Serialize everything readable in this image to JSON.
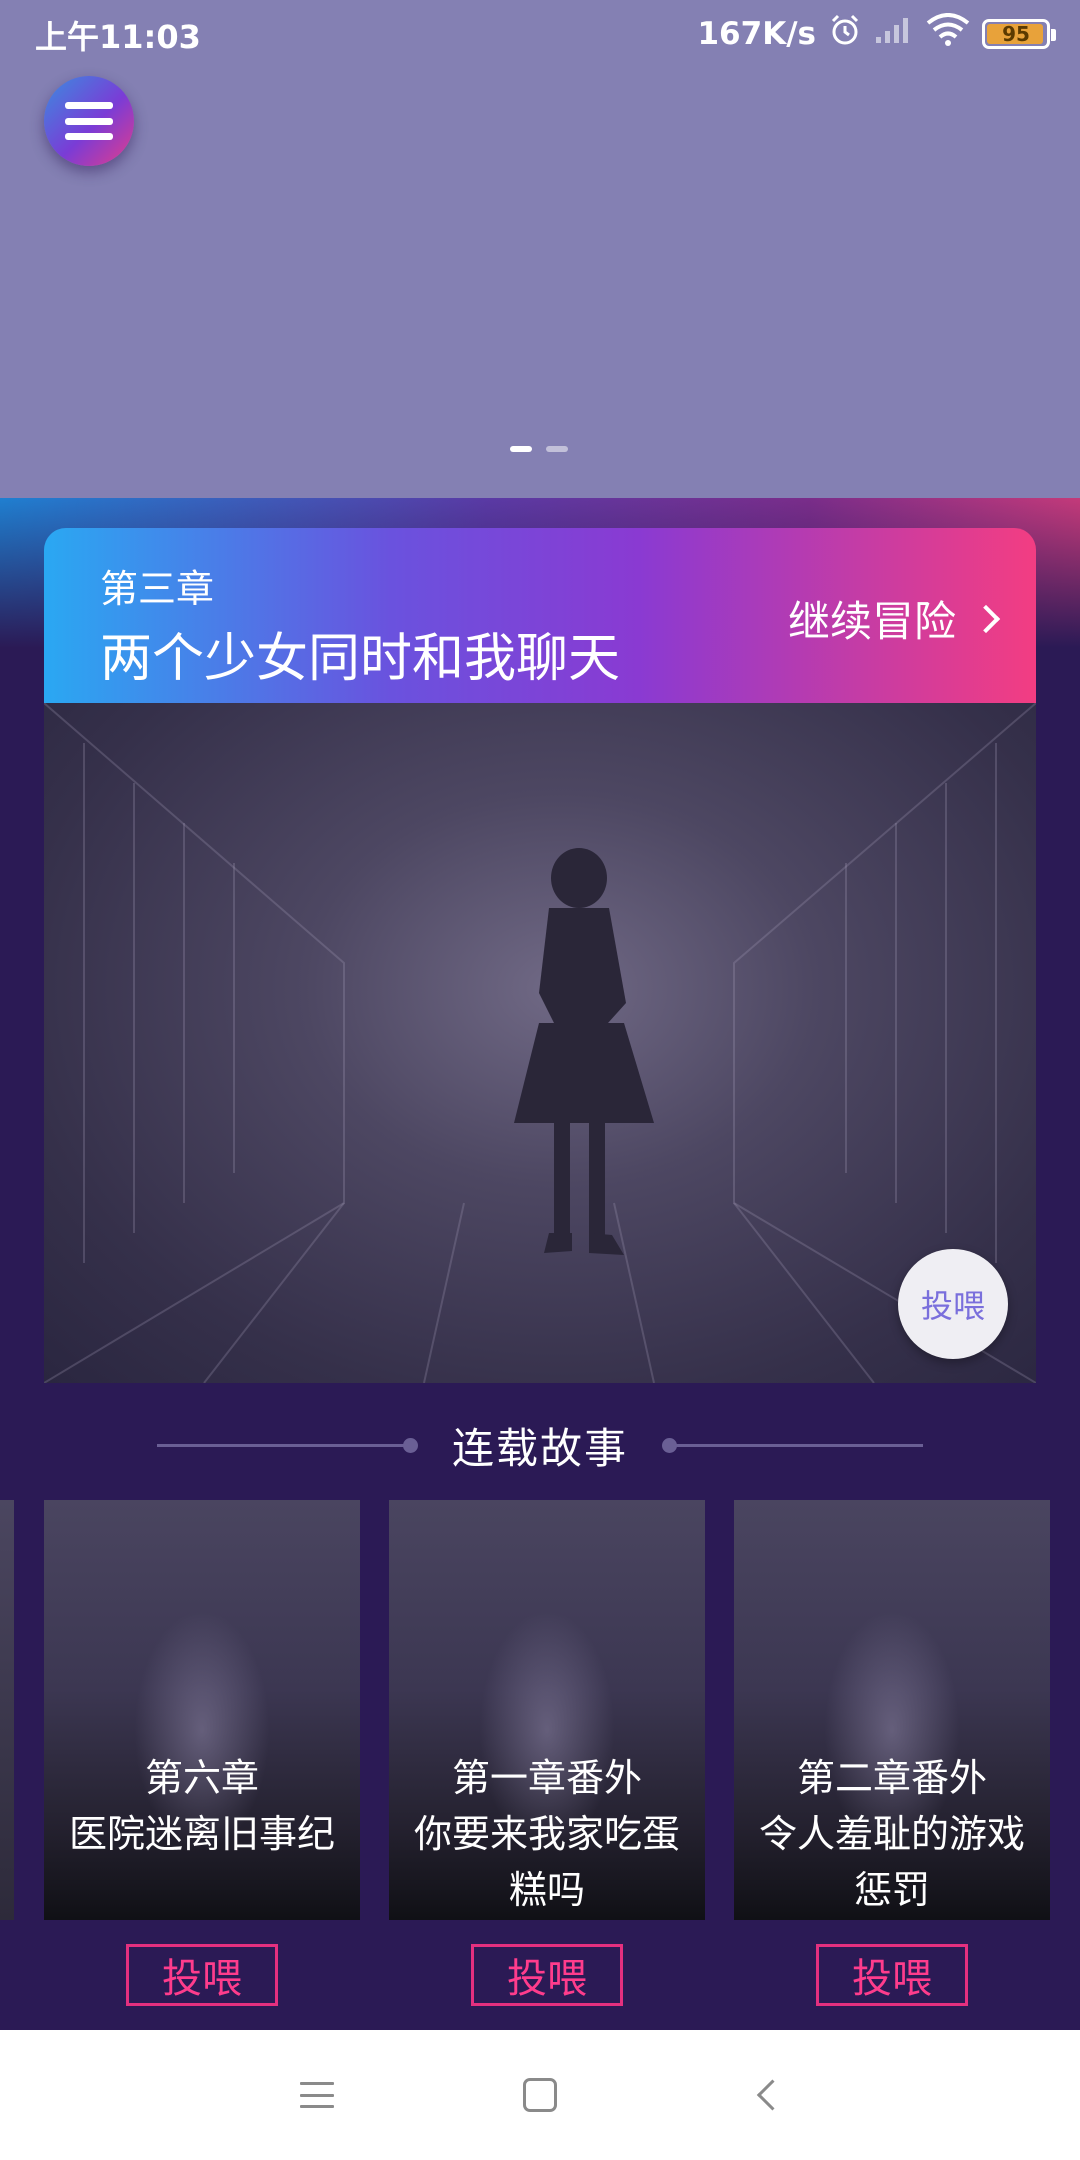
{
  "status_bar": {
    "time": "上午11:03",
    "speed": "167K/s",
    "battery_level": "95",
    "icons": [
      "alarm-icon",
      "signal-icon",
      "wifi-icon",
      "battery-icon"
    ]
  },
  "banner": {
    "page_indicator": {
      "total": 2,
      "active": 1
    }
  },
  "current_chapter": {
    "number": "第三章",
    "title": "两个少女同时和我聊天",
    "continue_label": "继续冒险",
    "feed_label": "投喂"
  },
  "section": {
    "title": "连载故事"
  },
  "stories": [
    {
      "chapter": "第六章",
      "name": "医院迷离旧事纪",
      "feed_label": "投喂"
    },
    {
      "chapter": "第一章番外",
      "name": "你要来我家吃蛋糕吗",
      "feed_label": "投喂"
    },
    {
      "chapter": "第二章番外",
      "name": "令人羞耻的游戏惩罚",
      "feed_label": "投喂"
    }
  ],
  "colors": {
    "banner_bg": "#8480b3",
    "page_bg": "#2b1a55",
    "header_gradient": [
      "#2aa8f2",
      "#8a3ad2",
      "#f33d82"
    ],
    "feed_accent": "#e4307f"
  }
}
